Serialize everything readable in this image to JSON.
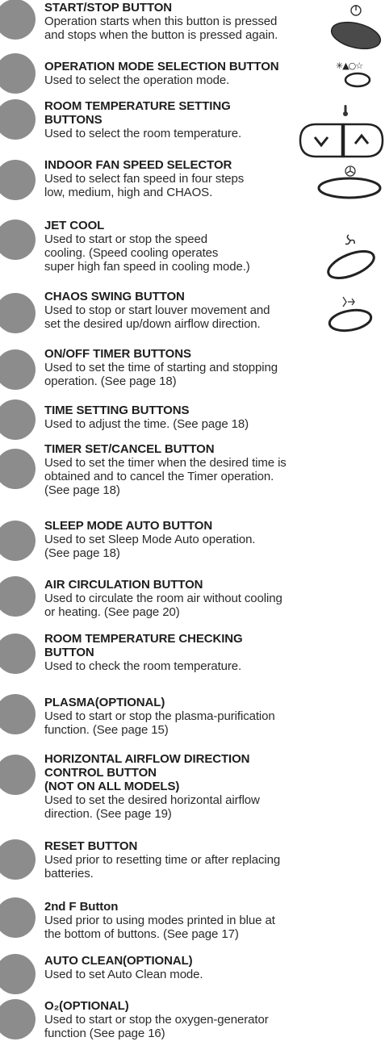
{
  "entries": [
    {
      "title": "START/STOP BUTTON",
      "desc": [
        "Operation starts when this button is pressed",
        "and stops when the button is pressed again."
      ]
    },
    {
      "title": "OPERATION MODE SELECTION BUTTON",
      "desc": [
        "Used to select the operation mode."
      ]
    },
    {
      "title": "ROOM TEMPERATURE SETTING",
      "title2": "BUTTONS",
      "desc": [
        "Used to select the room temperature."
      ]
    },
    {
      "title": "INDOOR FAN SPEED SELECTOR",
      "desc": [
        "Used to select fan speed in four steps",
        "low, medium, high and CHAOS."
      ]
    },
    {
      "title": "JET COOL",
      "desc": [
        "Used to start or stop the speed",
        "cooling. (Speed cooling operates",
        "super high fan speed in cooling mode.)"
      ]
    },
    {
      "title": "CHAOS SWING BUTTON",
      "desc": [
        "Used to stop or start louver movement and",
        "set the desired up/down airflow direction."
      ]
    },
    {
      "title": "ON/OFF TIMER BUTTONS",
      "desc": [
        "Used to set the time of starting and stopping",
        "operation. (See page 18)"
      ]
    },
    {
      "title": "TIME SETTING BUTTONS",
      "desc": [
        "Used to adjust the time. (See page 18)"
      ]
    },
    {
      "title": "TIMER SET/CANCEL BUTTON",
      "desc": [
        "Used to set the timer when the desired time is",
        "obtained and to cancel the Timer operation.",
        "(See page 18)"
      ]
    },
    {
      "title": "SLEEP MODE AUTO BUTTON",
      "desc": [
        "Used to set Sleep Mode Auto operation.",
        "(See page 18)"
      ]
    },
    {
      "title": "AIR CIRCULATION BUTTON",
      "desc": [
        "Used to circulate the room air without cooling",
        "or heating. (See page 20)"
      ]
    },
    {
      "title": "ROOM TEMPERATURE CHECKING",
      "title2": "BUTTON",
      "desc": [
        "Used to check the room temperature."
      ]
    },
    {
      "title": "PLASMA(OPTIONAL)",
      "desc": [
        "Used to start or stop the plasma-purification",
        "function. (See page 15)"
      ]
    },
    {
      "title": "HORIZONTAL AIRFLOW DIRECTION",
      "title2": "CONTROL BUTTON",
      "title3": "(NOT ON ALL MODELS)",
      "desc": [
        "Used to set the desired horizontal airflow",
        "direction. (See page 19)"
      ]
    },
    {
      "title": "RESET BUTTON",
      "desc": [
        "Used prior to resetting time or after replacing",
        "batteries."
      ]
    },
    {
      "title": "2nd F Button",
      "desc": [
        "Used prior to using modes printed in blue at",
        "the bottom of buttons. (See page 17)"
      ]
    },
    {
      "title": "AUTO CLEAN(OPTIONAL)",
      "desc": [
        "Used to set Auto Clean mode."
      ]
    },
    {
      "title": "O₂(OPTIONAL)",
      "desc": [
        "Used to start or stop the oxygen-generator",
        "function (See page 16)"
      ]
    }
  ],
  "icons": {
    "mode_symbols": "✳▲○☆",
    "power_symbol": "⏻"
  }
}
